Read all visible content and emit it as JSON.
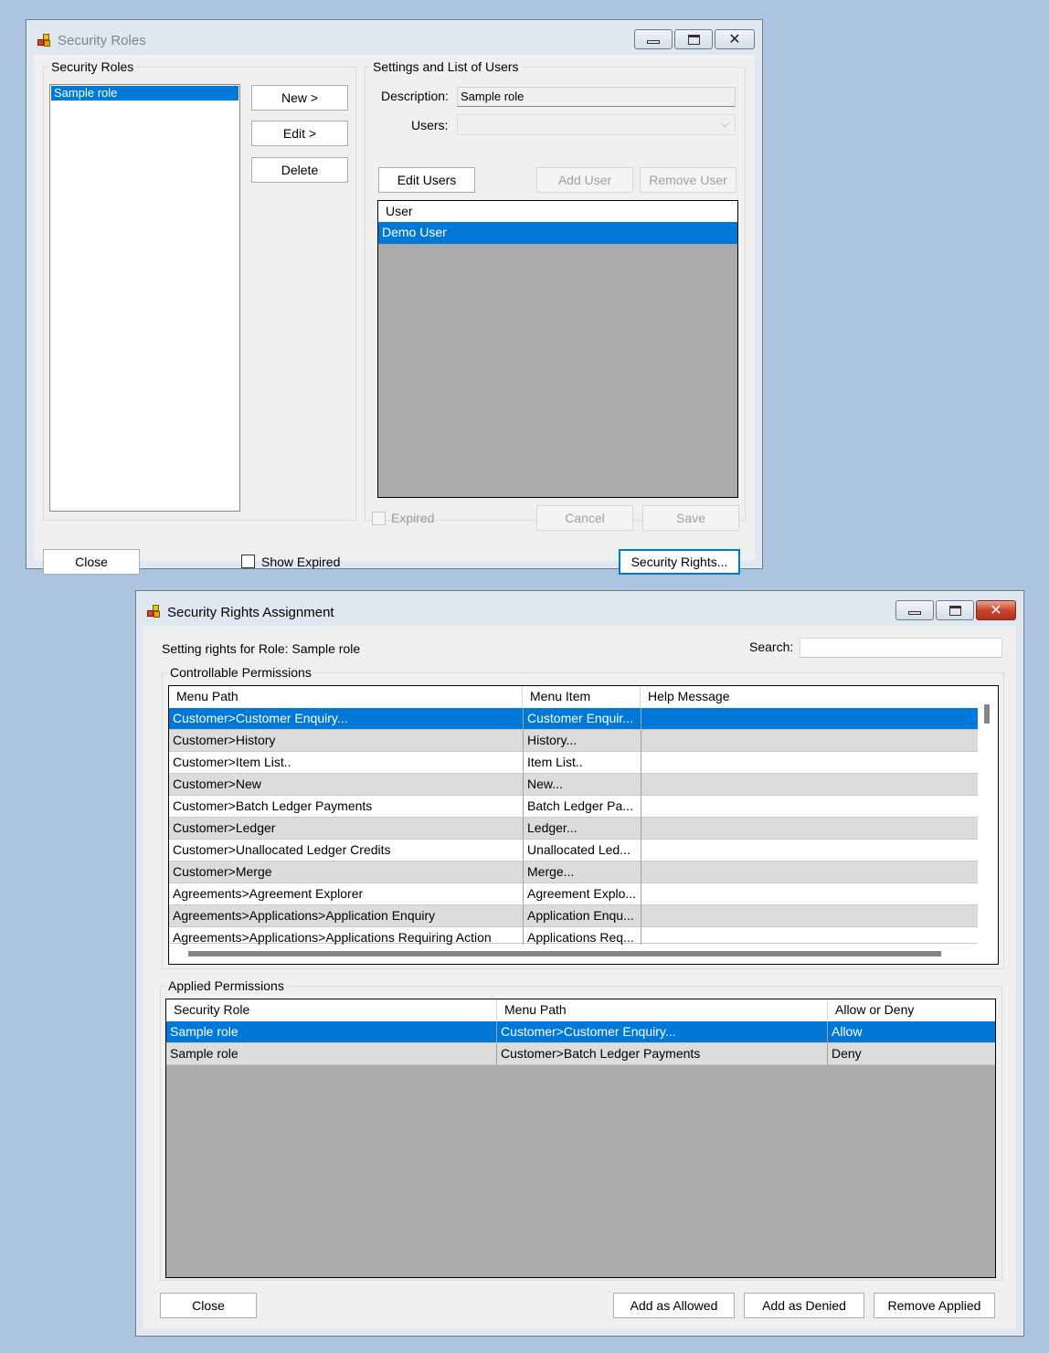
{
  "roles_window": {
    "title": "Security Roles",
    "roles_group_label": "Security Roles",
    "roles": [
      "Sample role"
    ],
    "new_button": "New >",
    "edit_button": "Edit >",
    "delete_button": "Delete",
    "settings_group_label": "Settings and List of Users",
    "description_label": "Description:",
    "description_value": "Sample role",
    "users_label": "Users:",
    "users_value": "",
    "edit_users_button": "Edit Users",
    "add_user_button": "Add User",
    "remove_user_button": "Remove User",
    "users_grid_header": "User",
    "users_grid_rows": [
      "Demo User"
    ],
    "expired_label": "Expired",
    "cancel_button": "Cancel",
    "save_button": "Save",
    "close_button": "Close",
    "show_expired_label": "Show Expired",
    "security_rights_button": "Security Rights..."
  },
  "rights_window": {
    "title": "Security Rights Assignment",
    "role_caption": "Setting rights for Role: Sample role",
    "search_label": "Search:",
    "search_value": "",
    "controllable_label": "Controllable Permissions",
    "controllable_headers": [
      "Menu Path",
      "Menu Item",
      "Help Message"
    ],
    "controllable_rows": [
      [
        "Customer>Customer Enquiry...",
        "Customer Enquir...",
        ""
      ],
      [
        "Customer>History",
        "History...",
        ""
      ],
      [
        "Customer>Item List..",
        "Item List..",
        ""
      ],
      [
        "Customer>New",
        "New...",
        ""
      ],
      [
        "Customer>Batch Ledger Payments",
        "Batch Ledger Pa...",
        ""
      ],
      [
        "Customer>Ledger",
        "Ledger...",
        ""
      ],
      [
        "Customer>Unallocated Ledger Credits",
        "Unallocated Led...",
        ""
      ],
      [
        "Customer>Merge",
        "Merge...",
        ""
      ],
      [
        "Agreements>Agreement Explorer",
        "Agreement Explo...",
        ""
      ],
      [
        "Agreements>Applications>Application Enquiry",
        "Application Enqu...",
        ""
      ],
      [
        "Agreements>Applications>Applications Requiring Action",
        "Applications Req...",
        ""
      ]
    ],
    "applied_label": "Applied Permissions",
    "applied_headers": [
      "Security Role",
      "Menu Path",
      "Allow or Deny"
    ],
    "applied_rows": [
      [
        "Sample role",
        "Customer>Customer Enquiry...",
        "Allow"
      ],
      [
        "Sample role",
        "Customer>Batch Ledger Payments",
        "Deny"
      ]
    ],
    "close_button": "Close",
    "add_allowed_button": "Add as Allowed",
    "add_denied_button": "Add as Denied",
    "remove_applied_button": "Remove Applied"
  },
  "colors": {
    "desktop": "#adc4e0",
    "selection": "#0078d7",
    "grid_background": "#ababab"
  }
}
